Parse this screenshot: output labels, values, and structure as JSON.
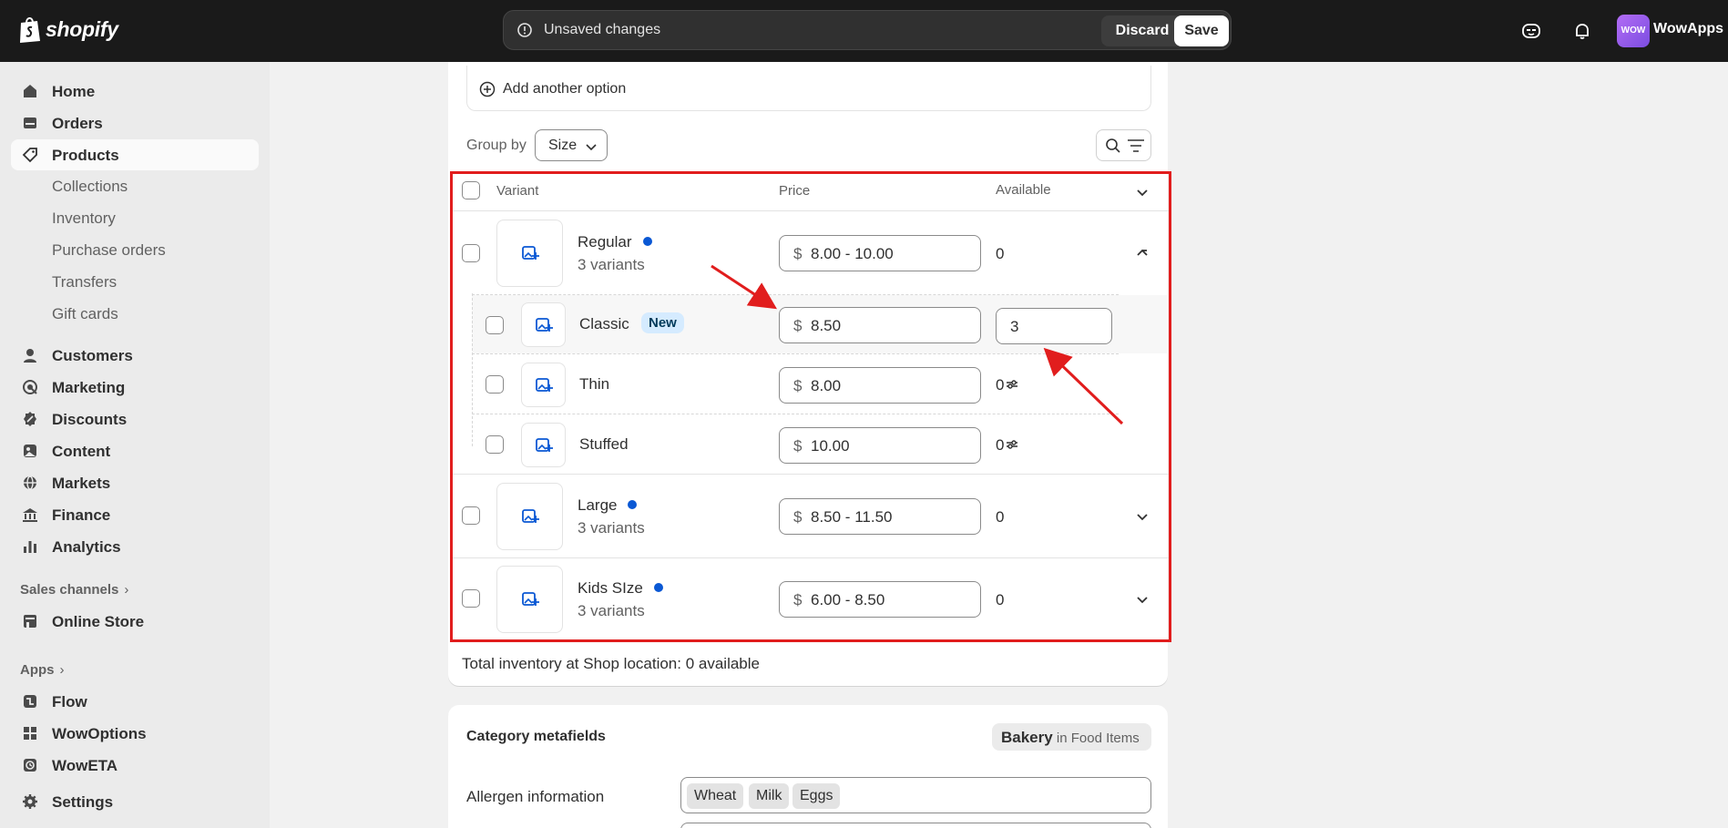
{
  "brand": {
    "name": "shopify"
  },
  "topbar": {
    "unsaved_text": "Unsaved changes",
    "discard_label": "Discard",
    "save_label": "Save",
    "store_avatar": "WOW",
    "store_name": "WowApps"
  },
  "sidebar": {
    "main": [
      {
        "label": "Home",
        "icon": "home-icon"
      },
      {
        "label": "Orders",
        "icon": "orders-icon"
      },
      {
        "label": "Products",
        "icon": "tag-icon",
        "active": true
      }
    ],
    "product_sub": [
      "Collections",
      "Inventory",
      "Purchase orders",
      "Transfers",
      "Gift cards"
    ],
    "more": [
      {
        "label": "Customers",
        "icon": "person-icon"
      },
      {
        "label": "Marketing",
        "icon": "target-icon"
      },
      {
        "label": "Discounts",
        "icon": "discount-icon"
      },
      {
        "label": "Content",
        "icon": "content-icon"
      },
      {
        "label": "Markets",
        "icon": "globe-icon"
      },
      {
        "label": "Finance",
        "icon": "bank-icon"
      },
      {
        "label": "Analytics",
        "icon": "chart-icon"
      }
    ],
    "sales_channels": "Sales channels",
    "online_store": "Online Store",
    "apps": "Apps",
    "app_items": [
      "Flow",
      "WowOptions",
      "WowETA"
    ],
    "settings": "Settings"
  },
  "variants": {
    "add_option": "Add another option",
    "group_by_label": "Group by",
    "group_by_value": "Size",
    "headers": {
      "variant": "Variant",
      "price": "Price",
      "available": "Available"
    },
    "currency": "$",
    "groups": [
      {
        "name": "Regular",
        "sub": "3 variants",
        "price": "8.00 - 10.00",
        "available": "0",
        "children": [
          {
            "name": "Classic",
            "badge": "New",
            "price": "8.50",
            "available": "3"
          },
          {
            "name": "Thin",
            "price": "8.00",
            "available": "0"
          },
          {
            "name": "Stuffed",
            "price": "10.00",
            "available": "0"
          }
        ]
      },
      {
        "name": "Large",
        "sub": "3 variants",
        "price": "8.50 - 11.50",
        "available": "0"
      },
      {
        "name": "Kids SIze",
        "sub": "3 variants",
        "price": "6.00 - 8.50",
        "available": "0"
      }
    ],
    "total_inventory": "Total inventory at Shop location: 0 available"
  },
  "metafields": {
    "title": "Category metafields",
    "category_name": "Bakery",
    "category_in": "in Food Items",
    "allergen_label": "Allergen information",
    "allergen_tags": [
      "Wheat",
      "Milk",
      "Eggs"
    ]
  },
  "colors": {
    "accent_blue": "#0a58d4",
    "highlight_red": "#e11d1d",
    "topbar": "#1a1a1a"
  }
}
